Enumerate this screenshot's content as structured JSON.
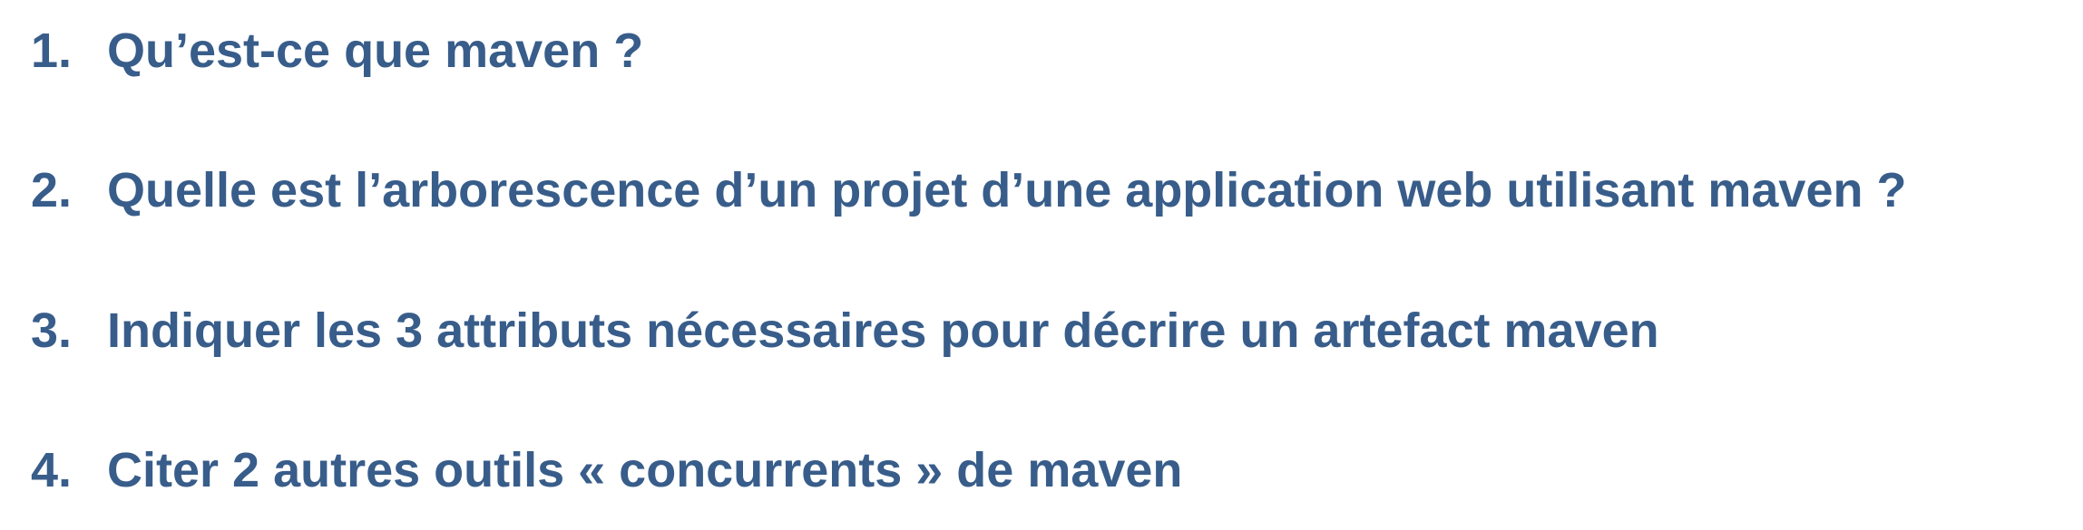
{
  "questions": [
    {
      "number": "1.",
      "text": "Qu’est-ce que maven ?"
    },
    {
      "number": "2.",
      "text": "Quelle est l’arborescence d’un projet d’une application web utilisant maven ?"
    },
    {
      "number": "3.",
      "text": "Indiquer les 3 attributs nécessaires pour décrire un artefact maven"
    },
    {
      "number": "4.",
      "text": "Citer 2 autres outils « concurrents » de maven"
    }
  ],
  "colors": {
    "text": "#385D8A",
    "background": "#FFFFFF"
  }
}
